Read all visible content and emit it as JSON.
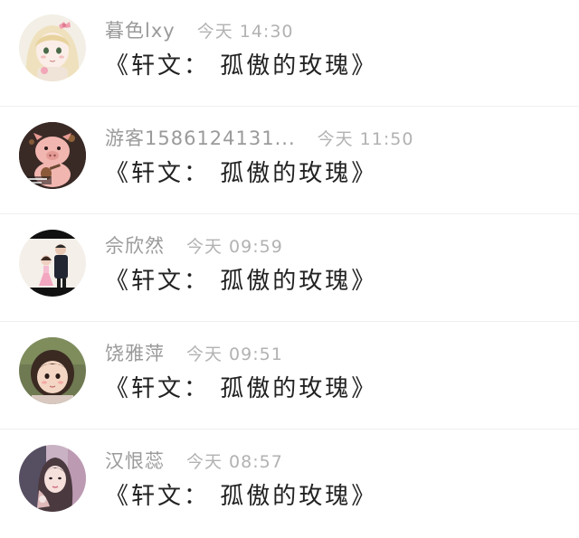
{
  "comments": [
    {
      "name": "暮色lxy",
      "time": "今天 14:30",
      "text": "《轩文： 孤傲的玫瑰》",
      "avatar_icon": "anime-girl-avatar"
    },
    {
      "name": "游客1586124131...",
      "time": "今天 11:50",
      "text": "《轩文： 孤傲的玫瑰》",
      "avatar_icon": "pig-avatar"
    },
    {
      "name": "佘欣然",
      "time": "今天 09:59",
      "text": "《轩文： 孤傲的玫瑰》",
      "avatar_icon": "couple-photo-avatar"
    },
    {
      "name": "饶雅萍",
      "time": "今天 09:51",
      "text": "《轩文： 孤傲的玫瑰》",
      "avatar_icon": "child-photo-avatar"
    },
    {
      "name": "汉恨蕊",
      "time": "今天 08:57",
      "text": "《轩文： 孤傲的玫瑰》",
      "avatar_icon": "girl-portrait-avatar"
    }
  ]
}
